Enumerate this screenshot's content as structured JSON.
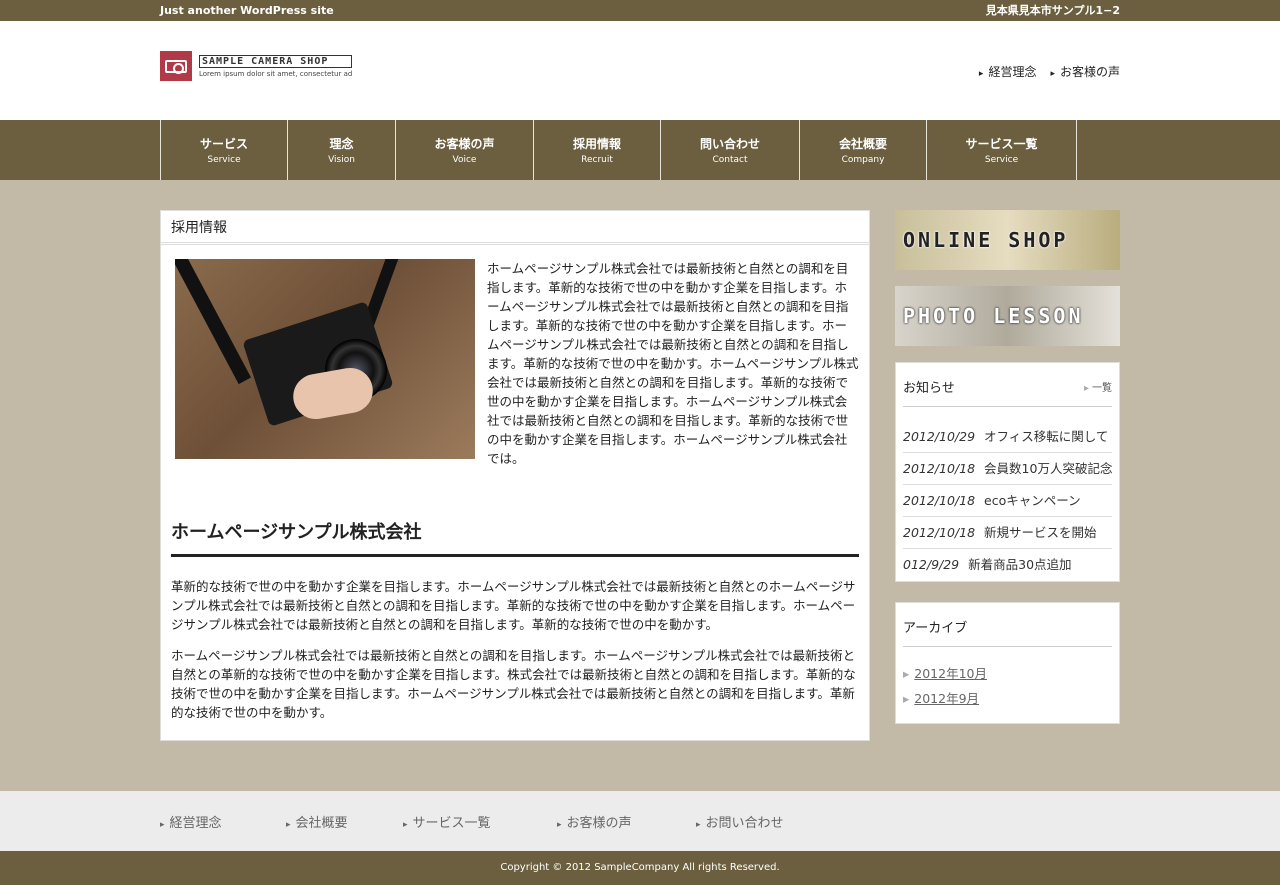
{
  "topbar": {
    "tagline": "Just another WordPress site",
    "address": "見本県見本市サンプル1−2"
  },
  "header": {
    "logo_title": "SAMPLE CAMERA SHOP",
    "logo_sub": "Lorem ipsum dolor sit amet, consectetur ad",
    "links": [
      "経営理念",
      "お客様の声"
    ]
  },
  "nav": [
    {
      "jp": "サービス",
      "en": "Service"
    },
    {
      "jp": "理念",
      "en": "Vision"
    },
    {
      "jp": "お客様の声",
      "en": "Voice"
    },
    {
      "jp": "採用情報",
      "en": "Recruit"
    },
    {
      "jp": "問い合わせ",
      "en": "Contact"
    },
    {
      "jp": "会社概要",
      "en": "Company"
    },
    {
      "jp": "サービス一覧",
      "en": "Service"
    }
  ],
  "content": {
    "heading": "採用情報",
    "intro": "ホームページサンプル株式会社では最新技術と自然との調和を目指します。革新的な技術で世の中を動かす企業を目指します。ホームページサンプル株式会社では最新技術と自然との調和を目指します。革新的な技術で世の中を動かす企業を目指します。ホームページサンプル株式会社では最新技術と自然との調和を目指します。革新的な技術で世の中を動かす。ホームページサンプル株式会社では最新技術と自然との調和を目指します。革新的な技術で世の中を動かす企業を目指します。ホームページサンプル株式会社では最新技術と自然との調和を目指します。革新的な技術で世の中を動かす企業を目指します。ホームページサンプル株式会社では。",
    "section_title": "ホームページサンプル株式会社",
    "para1": "革新的な技術で世の中を動かす企業を目指します。ホームページサンプル株式会社では最新技術と自然とのホームページサンプル株式会社では最新技術と自然との調和を目指します。革新的な技術で世の中を動かす企業を目指します。ホームページサンプル株式会社では最新技術と自然との調和を目指します。革新的な技術で世の中を動かす。",
    "para2": "ホームページサンプル株式会社では最新技術と自然との調和を目指します。ホームページサンプル株式会社では最新技術と自然との革新的な技術で世の中を動かす企業を目指します。株式会社では最新技術と自然との調和を目指します。革新的な技術で世の中を動かす企業を目指します。ホームページサンプル株式会社では最新技術と自然との調和を目指します。革新的な技術で世の中を動かす。"
  },
  "sidebar": {
    "banner1": "ONLINE SHOP",
    "banner2": "PHOTO LESSON",
    "news_title": "お知らせ",
    "news_more": "一覧",
    "news": [
      {
        "date": "2012/10/29",
        "title": "オフィス移転に関して"
      },
      {
        "date": "2012/10/18",
        "title": "会員数10万人突破記念"
      },
      {
        "date": "2012/10/18",
        "title": "ecoキャンペーン"
      },
      {
        "date": "2012/10/18",
        "title": "新規サービスを開始"
      },
      {
        "date": "012/9/29",
        "title": "新着商品30点追加"
      }
    ],
    "archive_title": "アーカイブ",
    "archive": [
      "2012年10月",
      "2012年9月"
    ]
  },
  "footer": {
    "links": [
      "経営理念",
      "会社概要",
      "サービス一覧",
      "お客様の声",
      "お問い合わせ"
    ],
    "copyright": "Copyright © 2012 SampleCompany All rights Reserved."
  }
}
